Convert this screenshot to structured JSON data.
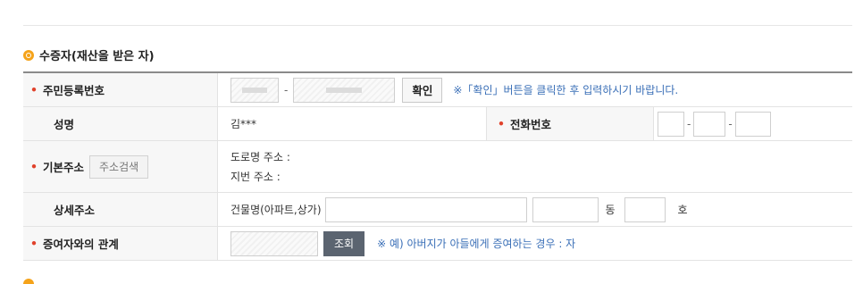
{
  "section": {
    "title": "수증자(재산을 받은 자)"
  },
  "rows": {
    "rrn": {
      "label": "주민등록번호",
      "dash": "-",
      "confirm_label": "확인",
      "note": "※「확인」버튼을 클릭한 후 입력하시기 바랍니다."
    },
    "name": {
      "label": "성명",
      "value": "김***",
      "phone_label": "전화번호",
      "dash": "-"
    },
    "address": {
      "label": "기본주소",
      "search_label": "주소검색",
      "road_label": "도로명 주소 :",
      "lot_label": "지번 주소 :"
    },
    "detail": {
      "label": "상세주소",
      "building_label": "건물명(아파트,상가)",
      "dong_label": "동",
      "ho_label": "호"
    },
    "relation": {
      "label": "증여자와의 관계",
      "lookup_label": "조회",
      "note": "※ 예) 아버지가 아들에게 증여하는 경우 : 자"
    }
  },
  "colors": {
    "accent": "#f5a31a",
    "required": "#e0412b",
    "note": "#3a6fb7",
    "dark_button": "#5b6470"
  }
}
